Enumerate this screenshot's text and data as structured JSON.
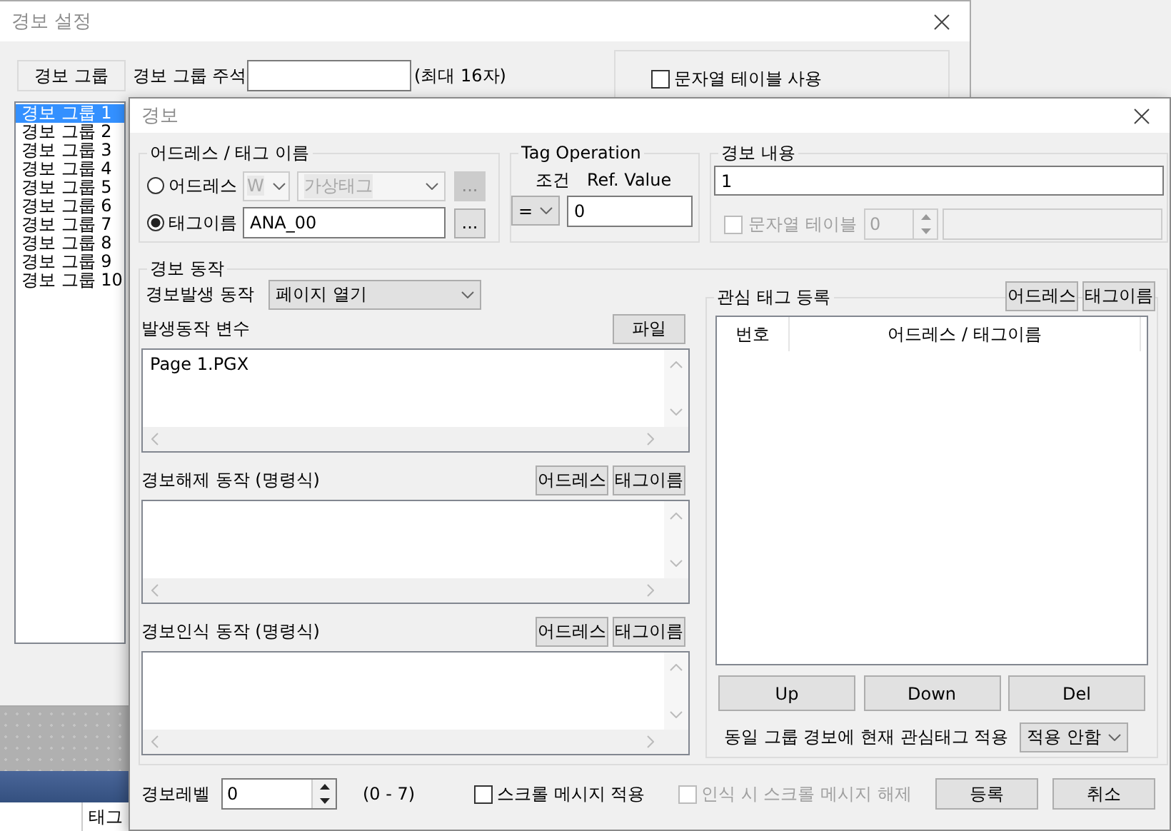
{
  "settings_window": {
    "title": "경보 설정",
    "tab": "경보 그룹",
    "comment_label": "경보 그룹 주석",
    "comment_hint": "(최대 16자)",
    "string_table": {
      "label": "문자열 테이블 사용",
      "checked": false
    },
    "groups": [
      {
        "label": "경보 그룹 1",
        "selected": true
      },
      {
        "label": "경보 그룹 2",
        "selected": false
      },
      {
        "label": "경보 그룹 3",
        "selected": false
      },
      {
        "label": "경보 그룹 4",
        "selected": false
      },
      {
        "label": "경보 그룹 5",
        "selected": false
      },
      {
        "label": "경보 그룹 6",
        "selected": false
      },
      {
        "label": "경보 그룹 7",
        "selected": false
      },
      {
        "label": "경보 그룹 8",
        "selected": false
      },
      {
        "label": "경보 그룹 9",
        "selected": false
      },
      {
        "label": "경보 그룹 10",
        "selected": false
      }
    ]
  },
  "tag_window": {
    "column": "태그"
  },
  "alarm_dialog": {
    "title": "경보",
    "address_group": {
      "title": "어드레스 / 태그 이름",
      "rows": [
        {
          "kind": "address",
          "label": "어드레스",
          "selected": false,
          "disabled": true,
          "device": "W",
          "tag_type": "가상태그",
          "browse": "..."
        },
        {
          "kind": "tag",
          "label": "태그이름",
          "selected": true,
          "disabled": false,
          "value": "ANA_00",
          "browse": "..."
        }
      ]
    },
    "tag_operation": {
      "title": "Tag Operation",
      "condition_label": "조건",
      "ref_label": "Ref. Value",
      "operator": "=",
      "ref_value": "0"
    },
    "alarm_content": {
      "title": "경보 내용",
      "value": "1",
      "string_table": {
        "label": "문자열 테이블",
        "checked": false,
        "disabled": true,
        "index": "0"
      }
    },
    "alarm_action": {
      "title": "경보 동작",
      "trigger_label": "경보발생 동작",
      "trigger_value": "페이지 열기",
      "sections": [
        {
          "label": "발생동작 변수",
          "buttons": [
            "파일"
          ],
          "text": "Page 1.PGX"
        },
        {
          "label": "경보해제 동작 (명령식)",
          "buttons": [
            "어드레스",
            "태그이름"
          ]
        },
        {
          "label": "경보인식 동작 (명령식)",
          "buttons": [
            "어드레스",
            "태그이름"
          ]
        }
      ],
      "watch_tags": {
        "title": "관심 태그 등록",
        "buttons": [
          "어드레스",
          "태그이름"
        ],
        "columns": [
          "번호",
          "어드레스 / 태그이름"
        ],
        "actions": [
          "Up",
          "Down",
          "Del"
        ],
        "apply_label": "동일 그룹 경보에 현재 관심태그 적용",
        "apply_value": "적용 안함"
      }
    },
    "footer": {
      "level_label": "경보레벨",
      "level_value": "0",
      "range": "(0 - 7)",
      "checks": [
        {
          "label": "스크롤 메시지 적용",
          "checked": false,
          "disabled": false
        },
        {
          "label": "인식 시 스크롤 메시지 해제",
          "checked": false,
          "disabled": true
        }
      ],
      "buttons": [
        "등록",
        "취소"
      ]
    }
  }
}
